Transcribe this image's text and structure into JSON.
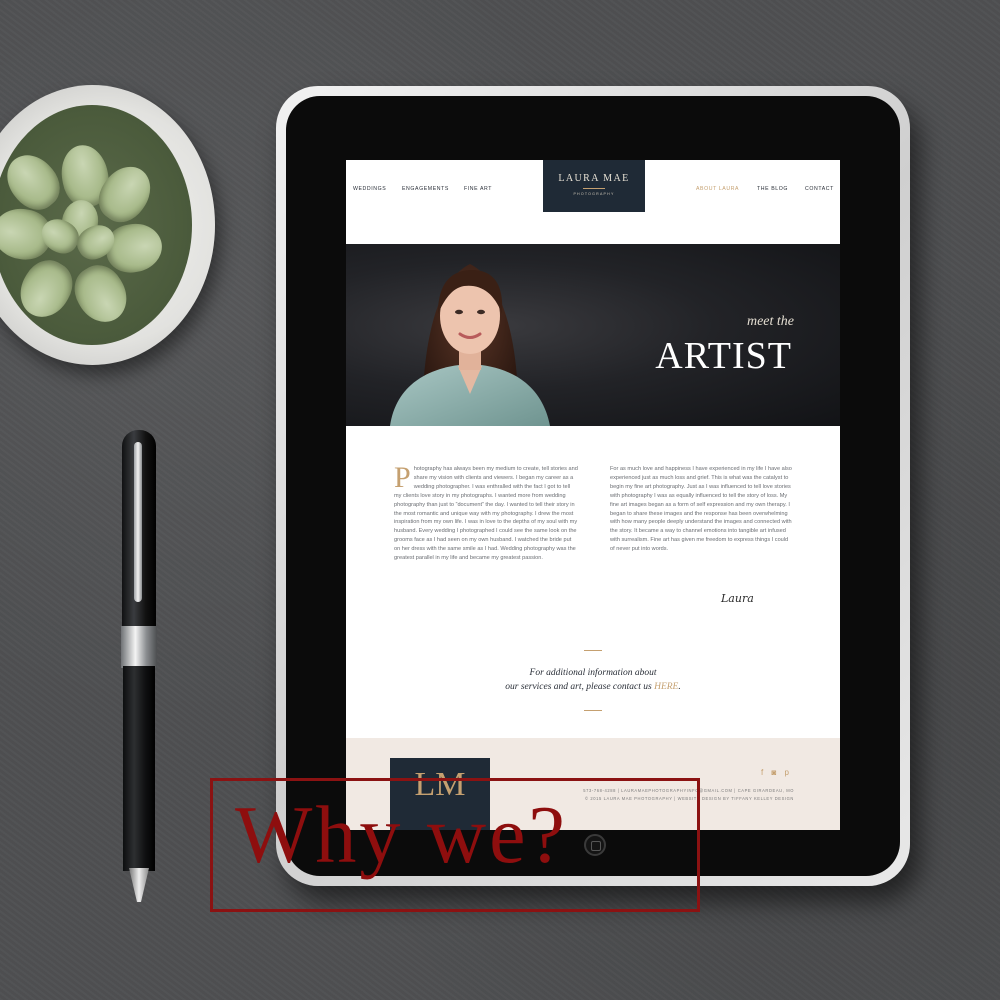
{
  "website": {
    "nav": {
      "left": [
        "WEDDINGS",
        "ENGAGEMENTS",
        "FINE ART"
      ],
      "right": [
        "ABOUT LAURA",
        "THE BLOG",
        "CONTACT"
      ],
      "active": "ABOUT LAURA"
    },
    "logo": {
      "name": "LAURA MAE",
      "sub": "PHOTOGRAPHY"
    },
    "hero": {
      "kicker": "meet the",
      "title": "ARTIST"
    },
    "about": {
      "dropcap": "P",
      "left_text": "hotography has always been my medium to create, tell stories and share my vision with clients and viewers. I began my career as a wedding photographer. I was enthralled with the fact I got to tell my clients love story in my photographs. I wanted more from wedding photography than just to “document” the day. I wanted to tell their story in the most romantic and unique way with my photography. I drew the most inspiration from my own life. I was in love to the depths of my soul with my husband. Every wedding I photographed I could see the same look on the grooms face as I had seen on my own husband. I watched the bride put on her dress with the same smile as I had. Wedding photography was the greatest parallel in my life and became my greatest passion.",
      "right_text": "For as much love and happiness I have experienced in my life I have also experienced just as much loss and grief. This is what was the catalyst to begin my fine art photography. Just as I was influenced to tell love stories with photography I was as equally influenced to tell the story of loss. My fine art images began as a form of self expression and my own therapy. I began to share these images and the response has been overwhelming with how many people deeply understand the images and connected with the story. It became a way to channel emotions into tangible art infused with surrealism. Fine art has given me freedom to express things I could of never put into words.",
      "signature": "Laura"
    },
    "info": {
      "line1": "For additional information about",
      "line2_prefix": "our services and art, please contact us ",
      "link": "HERE",
      "line2_suffix": "."
    },
    "footer": {
      "logo_mark": "LM",
      "social_icons": "f ◙ p",
      "contact_line": "573-768-4288   |   LAURAMAEPHOTOGRAPHYINFO@GMAIL.COM   |   CAPE GIRARDEAU, MO",
      "copyright_line": "© 2015 LAURA MAE PHOTOGRAPHY   |   WEBSITE DESIGN BY TIFFANY KELLEY DESIGN"
    }
  },
  "overlay": {
    "text": "Why we?"
  },
  "colors": {
    "navy": "#1f2a36",
    "gold": "#c5a070",
    "overlay_red": "#8e0e0e",
    "footer_blush": "#f1e9e3"
  }
}
